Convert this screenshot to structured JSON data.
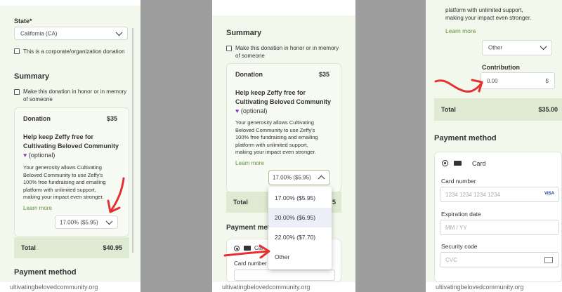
{
  "panel1": {
    "state_label": "State*",
    "state_value": "California (CA)",
    "corporate_label": "This is a corporate/organization donation",
    "summary_title": "Summary",
    "honor_line1": "Make this donation in honor or in memory",
    "honor_line2": "of someone",
    "donation_label": "Donation",
    "donation_amount": "$35",
    "help_line1": "Help keep Zeffy free for",
    "help_line2": "Cultivating Beloved Community",
    "optional": "(optional)",
    "desc": [
      "Your generosity allows Cultivating",
      "Beloved Community to use Zeffy's",
      "100% free fundraising and emailing",
      "platform with unlimited support,",
      "making your impact even stronger."
    ],
    "learn_more": "Learn more",
    "tip_value": "17.00% ($5.95)",
    "total_label": "Total",
    "total_value": "$40.95",
    "payment_title": "Payment method",
    "footer": "ultivatingbelovedcommunity.org"
  },
  "panel2": {
    "summary_title": "Summary",
    "honor_line1": "Make this donation in honor or in memory",
    "honor_line2": "of someone",
    "donation_label": "Donation",
    "donation_amount": "$35",
    "help_line1": "Help keep Zeffy free for",
    "help_line2": "Cultivating Beloved Community",
    "optional": "(optional)",
    "desc": [
      "Your generosity allows Cultivating",
      "Beloved Community to use Zeffy's",
      "100% free fundraising and emailing",
      "platform with unlimited support,",
      "making your impact even stronger."
    ],
    "learn_more": "Learn more",
    "tip_value": "17.00% ($5.95)",
    "options": [
      "17.00% ($5.95)",
      "20.00% ($6.95)",
      "22.00% ($7.70)",
      "Other"
    ],
    "total_label": "Total",
    "total_partial": "5",
    "payment_title": "Payment meth",
    "card_partial": "Car",
    "card_number_label": "Card number",
    "footer": "ultivatingbelovedcommunity.org"
  },
  "panel3": {
    "top_line1": "platform with unlimited support,",
    "top_line2": "making your impact even stronger.",
    "learn_more": "Learn more",
    "tip_value": "Other",
    "contribution_label": "Contribution",
    "contribution_value": "0.00",
    "currency": "$",
    "total_label": "Total",
    "total_value": "$35.00",
    "payment_title": "Payment method",
    "card_label": "Card",
    "card_number_label": "Card number",
    "card_number_placeholder": "1234 1234 1234 1234",
    "visa": "VISA",
    "expiration_label": "Expiration date",
    "expiration_placeholder": "MM / YY",
    "security_label": "Security code",
    "security_placeholder": "CVC",
    "footer": "ultivatingbelovedcommunity.org"
  },
  "colors": {
    "accent_green": "#5f8f3b",
    "total_bg": "#dfead3",
    "annotation_red": "#e53030",
    "heart": "#8a46c8"
  }
}
